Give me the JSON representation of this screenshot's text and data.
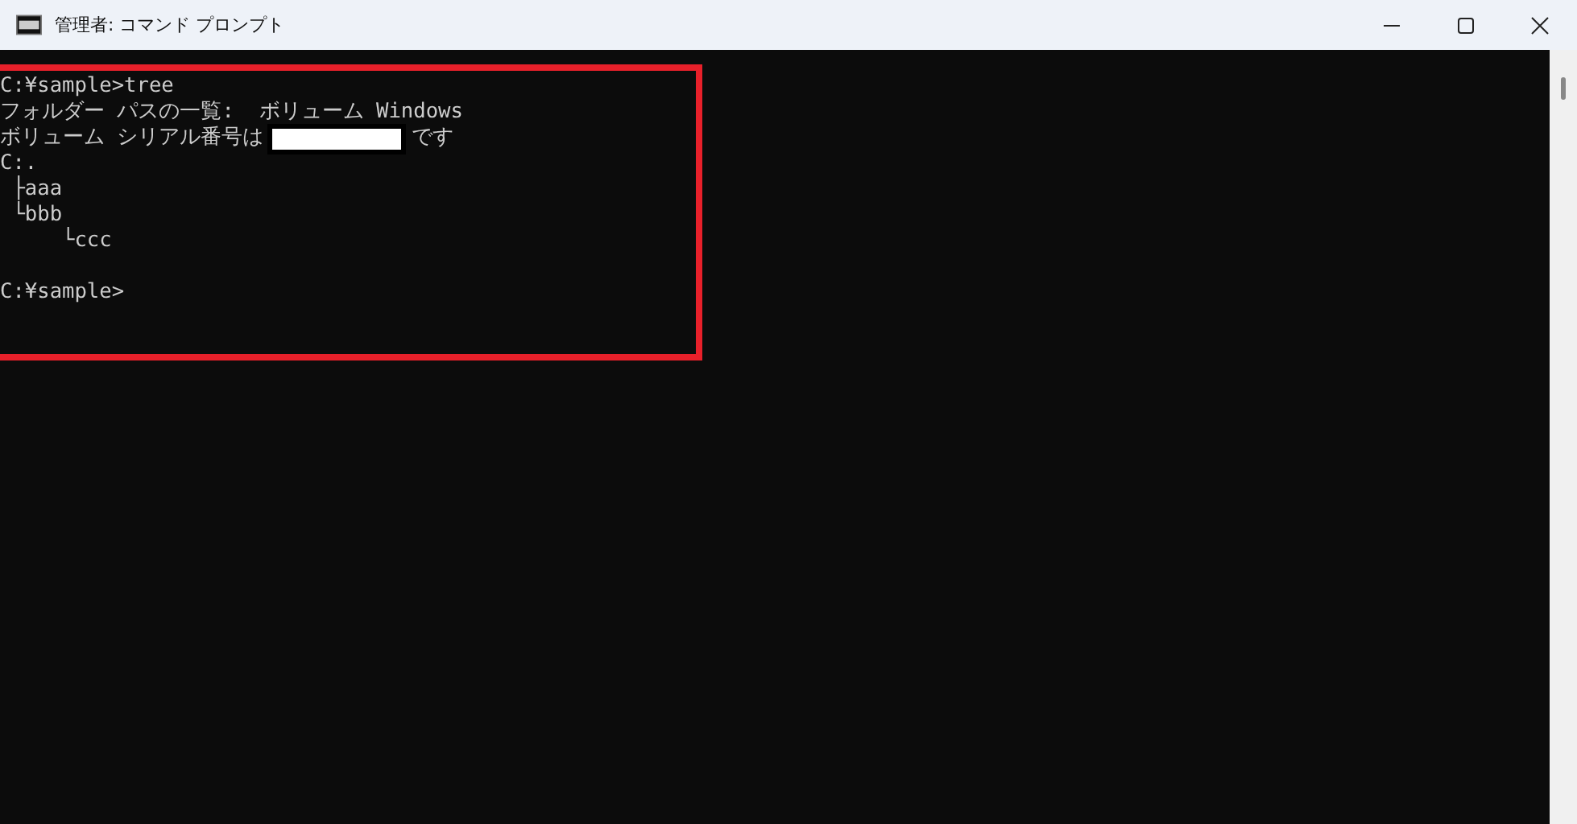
{
  "window": {
    "title": "管理者: コマンド プロンプト"
  },
  "console": {
    "lines": [
      {
        "kind": "text",
        "text": "C:¥sample>tree"
      },
      {
        "kind": "text",
        "text": "フォルダー パスの一覧:  ボリューム Windows"
      },
      {
        "kind": "redacted",
        "before": "ボリューム シリアル番号は",
        "after": "です"
      },
      {
        "kind": "text",
        "text": "C:."
      },
      {
        "kind": "text",
        "text": " ├aaa"
      },
      {
        "kind": "text",
        "text": " └bbb"
      },
      {
        "kind": "text",
        "text": "     └ccc"
      },
      {
        "kind": "blank"
      },
      {
        "kind": "text",
        "text": "C:¥sample>"
      }
    ],
    "highlighted": true
  }
}
